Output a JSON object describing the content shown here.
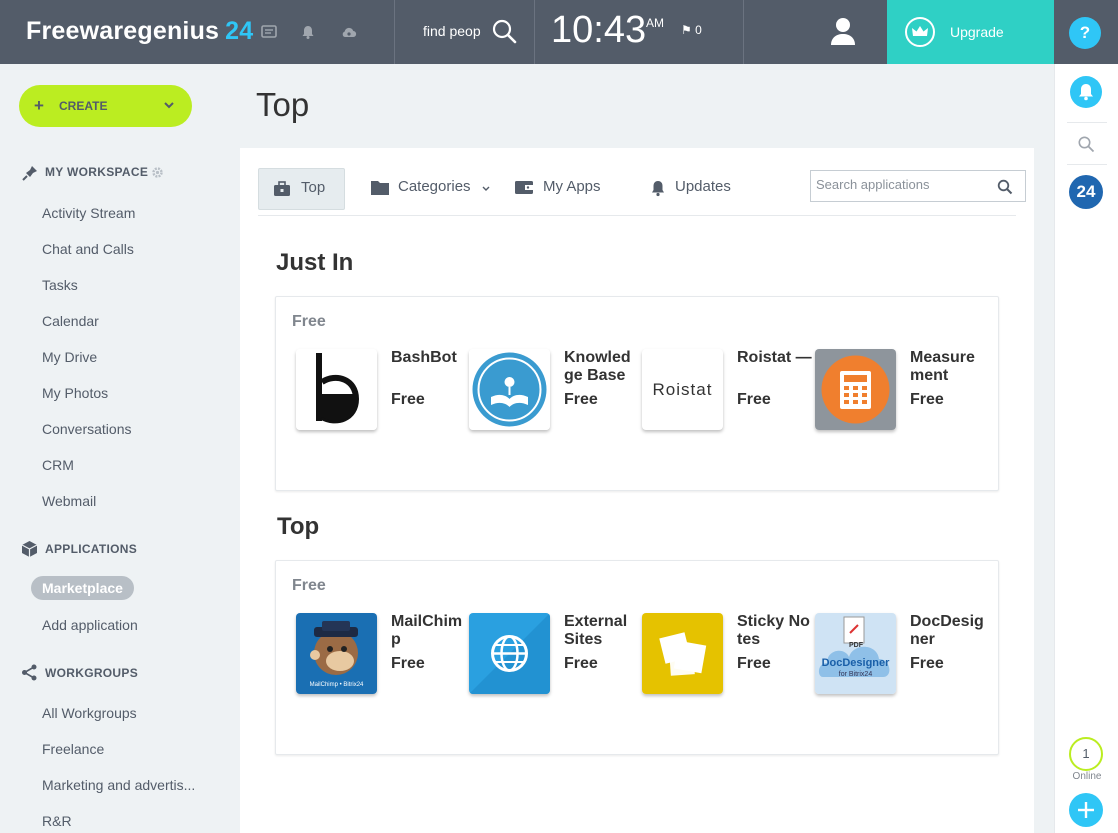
{
  "brand": {
    "name": "Freewaregenius",
    "suffix": "24"
  },
  "topbar": {
    "find_people": "find people",
    "time": "10:43",
    "ampm": "AM",
    "flag_count": "0",
    "upgrade": "Upgrade",
    "help": "?"
  },
  "sidebar": {
    "create": "CREATE",
    "workspace_title": "MY WORKSPACE",
    "workspace_items": [
      "Activity Stream",
      "Chat and Calls",
      "Tasks",
      "Calendar",
      "My Drive",
      "My Photos",
      "Conversations",
      "CRM",
      "Webmail"
    ],
    "applications_title": "APPLICATIONS",
    "applications_items": [
      "Marketplace",
      "Add application"
    ],
    "workgroups_title": "WORKGROUPS",
    "workgroups_items": [
      "All Workgroups",
      "Freelance",
      "Marketing and advertis...",
      "R&R"
    ]
  },
  "rightbar": {
    "badge": "24",
    "online_count": "1",
    "online_label": "Online"
  },
  "page": {
    "title": "Top",
    "tabs": {
      "top": "Top",
      "categories": "Categories",
      "myapps": "My Apps",
      "updates": "Updates"
    },
    "search_placeholder": "Search applications"
  },
  "sections": [
    {
      "title": "Just In",
      "subtitle": "Free",
      "apps": [
        {
          "name": "BashBot",
          "price": "Free"
        },
        {
          "name": "Knowledge Base",
          "price": "Free"
        },
        {
          "name": "Roistat —",
          "price": "Free",
          "logo_text": "Roistat"
        },
        {
          "name": "Measurement",
          "price": "Free"
        }
      ]
    },
    {
      "title": "Top",
      "subtitle": "Free",
      "apps": [
        {
          "name": "MailChimp",
          "price": "Free",
          "logo_text": "MailChimp • Bitrix24"
        },
        {
          "name": "External Sites",
          "price": "Free"
        },
        {
          "name": "Sticky Notes",
          "price": "Free"
        },
        {
          "name": "DocDesigner",
          "price": "Free",
          "logo_text": "DocDesigner",
          "logo_sub": "for Bitrix24",
          "logo_pdf": "PDF"
        }
      ]
    }
  ],
  "colors": {
    "topbar": "#535c69",
    "accent": "#2fc6f6",
    "create": "#bbed21",
    "upgrade": "#2fd0c5"
  }
}
